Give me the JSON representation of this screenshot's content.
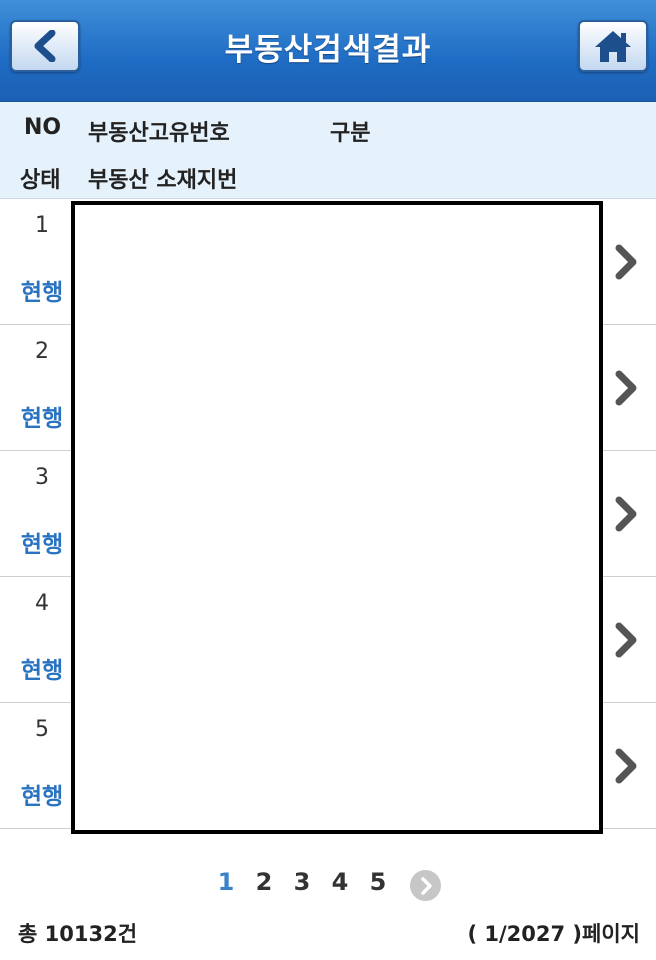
{
  "header": {
    "title": "부동산검색결과",
    "back_icon": "chevron-left-icon",
    "home_icon": "home-icon"
  },
  "list_header": {
    "no": "NO",
    "unique_number": "부동산고유번호",
    "category": "구분",
    "status": "상태",
    "address": "부동산 소재지번"
  },
  "rows": [
    {
      "no": "1",
      "status": "현행"
    },
    {
      "no": "2",
      "status": "현행"
    },
    {
      "no": "3",
      "status": "현행"
    },
    {
      "no": "4",
      "status": "현행"
    },
    {
      "no": "5",
      "status": "현행"
    }
  ],
  "pagination": {
    "pages": [
      "1",
      "2",
      "3",
      "4",
      "5"
    ],
    "current": "1",
    "next_icon": "chevron-right-circle-icon"
  },
  "footer": {
    "total": "총 10132건",
    "page_info": "( 1/2027 )페이지"
  },
  "colors": {
    "header_blue": "#1f6cc4",
    "status_blue": "#2a73c1",
    "list_header_bg": "#e5f1fb",
    "active_page": "#3b82c8"
  }
}
